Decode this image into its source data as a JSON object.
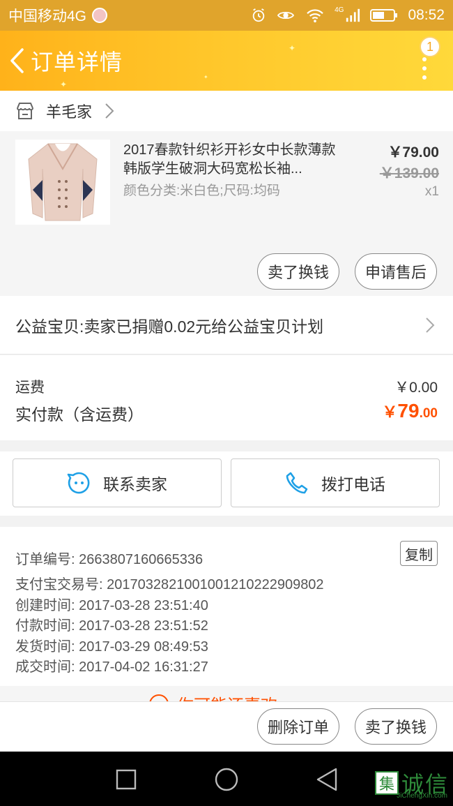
{
  "status_bar": {
    "carrier": "中国移动4G",
    "network": "4G",
    "time": "08:52"
  },
  "nav": {
    "title": "订单详情",
    "badge": "1"
  },
  "shop": {
    "name": "羊毛家"
  },
  "product": {
    "title": "2017春款针织衫开衫女中长款薄款韩版学生破洞大码宽松长袖...",
    "spec": "颜色分类:米白色;尺码:均码",
    "price": "￥79.00",
    "original_price": "￥139.00",
    "quantity": "x1",
    "btn_sell": "卖了换钱",
    "btn_aftersale": "申请售后"
  },
  "charity": {
    "text": "公益宝贝:卖家已捐赠0.02元给公益宝贝计划"
  },
  "fees": {
    "shipping_label": "运费",
    "shipping_value": "￥0.00",
    "paid_label": "实付款（含运费）",
    "paid_currency": "￥",
    "paid_integer": "79",
    "paid_decimal": ".00"
  },
  "contact": {
    "seller": "联系卖家",
    "phone": "拨打电话"
  },
  "order_info": {
    "copy": "复制",
    "lines": [
      "订单编号: 2663807160665336",
      "支付宝交易号: 2017032821001001210222909802",
      "创建时间: 2017-03-28 23:51:40",
      "付款时间: 2017-03-28 23:51:52",
      "发货时间: 2017-03-29 08:49:53",
      "成交时间: 2017-04-02 16:31:27"
    ]
  },
  "partial_banner": {
    "text": "你可能还喜欢"
  },
  "actions": {
    "delete": "删除订单",
    "sell": "卖了换钱"
  },
  "watermark": {
    "logo_char": "集",
    "name": "诚信",
    "site": "JiChengXin.com"
  },
  "colors": {
    "status_bar": "#e0a42c",
    "nav_gradient_start": "#ffb21a",
    "nav_gradient_end": "#ffd93a",
    "accent_orange": "#ff5000",
    "contact_icon_blue": "#1ea0e6"
  }
}
